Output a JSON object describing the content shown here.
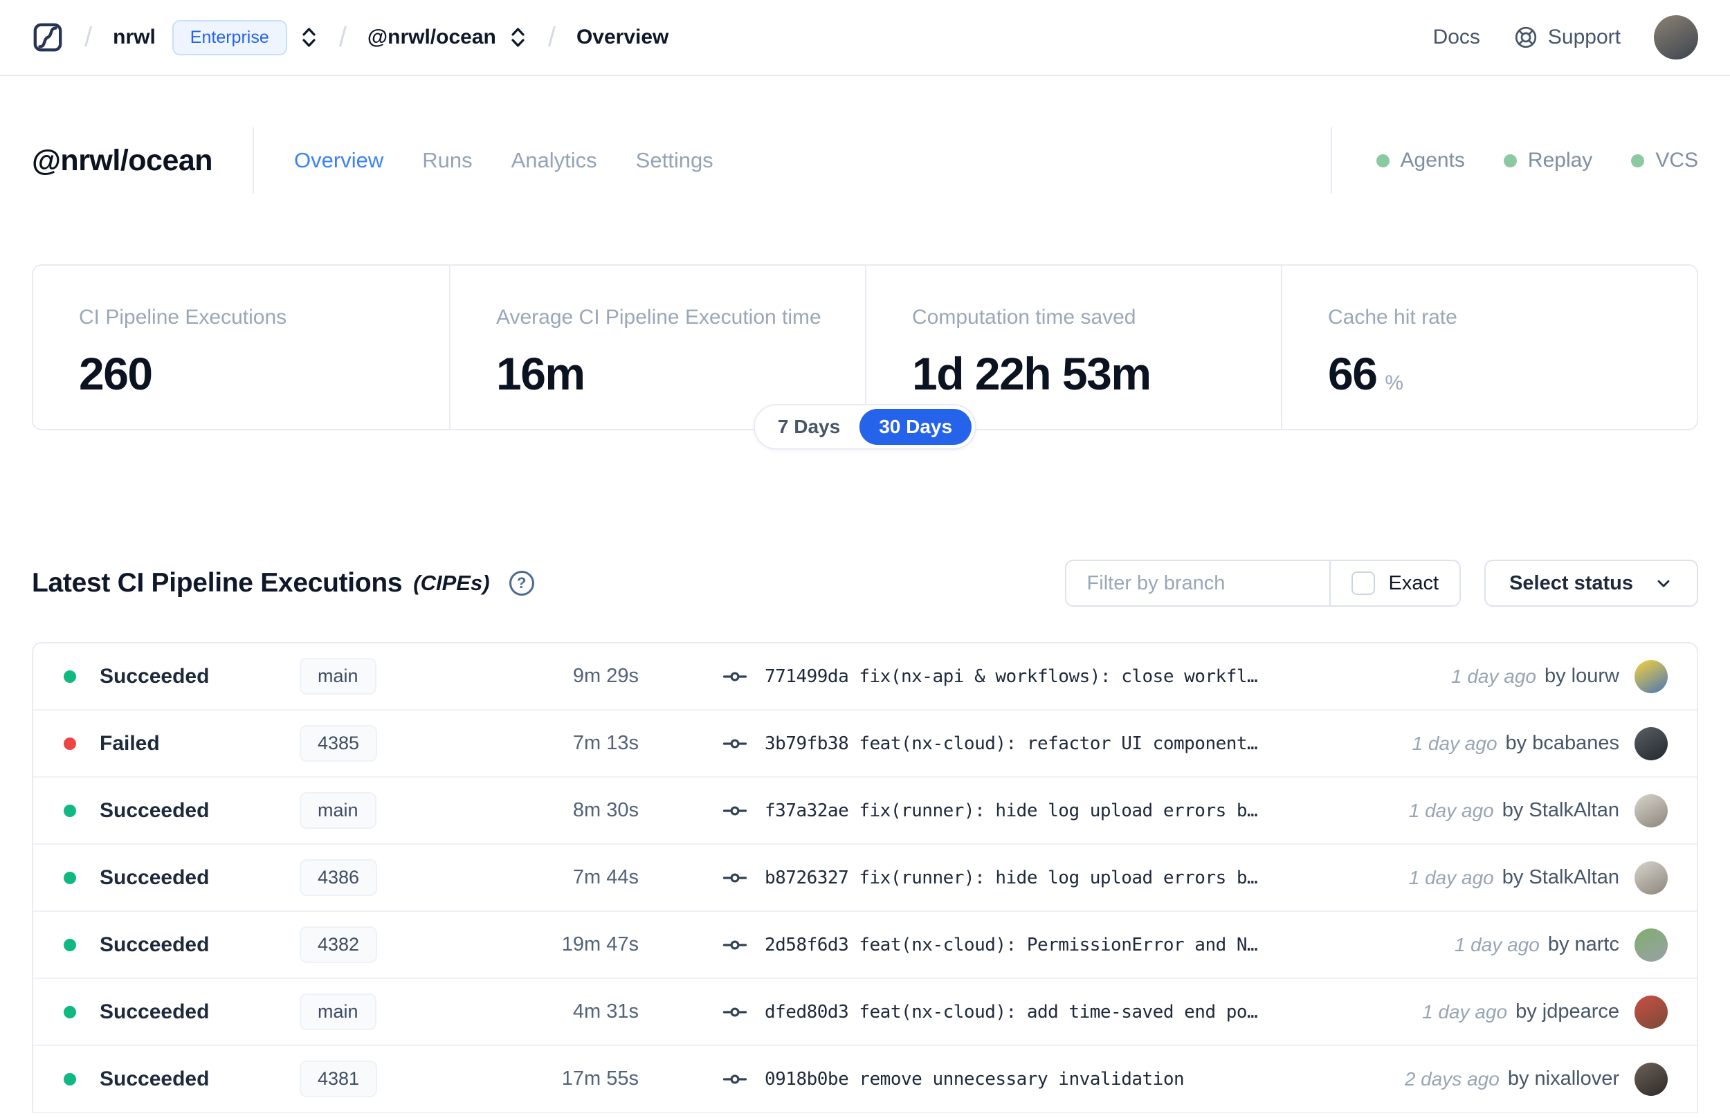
{
  "topbar": {
    "breadcrumb": {
      "separator": "/",
      "org": "nrwl",
      "org_badge": "Enterprise",
      "workspace": "@nrwl/ocean",
      "page": "Overview"
    },
    "docs_label": "Docs",
    "support_label": "Support",
    "user_avatar_colors": [
      "#8c8272",
      "#3c4450"
    ]
  },
  "header": {
    "title": "@nrwl/ocean",
    "tabs": [
      {
        "label": "Overview",
        "active": true
      },
      {
        "label": "Runs",
        "active": false
      },
      {
        "label": "Analytics",
        "active": false
      },
      {
        "label": "Settings",
        "active": false
      }
    ],
    "statuses": [
      {
        "label": "Agents",
        "dot_color": "#8bcaa1"
      },
      {
        "label": "Replay",
        "dot_color": "#8bcaa1"
      },
      {
        "label": "VCS",
        "dot_color": "#8bcaa1"
      }
    ]
  },
  "stats": {
    "cards": [
      {
        "label": "CI Pipeline Executions",
        "value": "260",
        "suffix": ""
      },
      {
        "label": "Average CI Pipeline Execution time",
        "value": "16m",
        "suffix": ""
      },
      {
        "label": "Computation time saved",
        "value": "1d 22h 53m",
        "suffix": ""
      },
      {
        "label": "Cache hit rate",
        "value": "66",
        "suffix": "%"
      }
    ],
    "range_toggle": {
      "options": [
        "7 Days",
        "30 Days"
      ],
      "selected": "30 Days",
      "selected_color": "#2563eb"
    }
  },
  "executions": {
    "title": "Latest CI Pipeline Executions",
    "title_suffix": "(CIPEs)",
    "help_glyph": "?",
    "filter_placeholder": "Filter by branch",
    "exact_label": "Exact",
    "status_select_label": "Select status",
    "status_colors": {
      "succeeded": "#10b981",
      "failed": "#ef4444"
    },
    "rows": [
      {
        "status": "Succeeded",
        "dot_color": "#10b981",
        "branch": "main",
        "duration": "9m 29s",
        "commit": "771499da fix(nx-api & workflows): close workfl…",
        "time": "1 day ago",
        "author": "by lourw",
        "avatar": [
          "#f6d33c",
          "#4a76b8"
        ]
      },
      {
        "status": "Failed",
        "dot_color": "#ef4444",
        "branch": "4385",
        "duration": "7m 13s",
        "commit": "3b79fb38 feat(nx-cloud): refactor UI component…",
        "time": "1 day ago",
        "author": "by bcabanes",
        "avatar": [
          "#5a5f66",
          "#23272e"
        ]
      },
      {
        "status": "Succeeded",
        "dot_color": "#10b981",
        "branch": "main",
        "duration": "8m 30s",
        "commit": "f37a32ae fix(runner): hide log upload errors b…",
        "time": "1 day ago",
        "author": "by StalkAltan",
        "avatar": [
          "#d8d4cd",
          "#8c857b"
        ]
      },
      {
        "status": "Succeeded",
        "dot_color": "#10b981",
        "branch": "4386",
        "duration": "7m 44s",
        "commit": "b8726327 fix(runner): hide log upload errors b…",
        "time": "1 day ago",
        "author": "by StalkAltan",
        "avatar": [
          "#d8d4cd",
          "#8c857b"
        ]
      },
      {
        "status": "Succeeded",
        "dot_color": "#10b981",
        "branch": "4382",
        "duration": "19m 47s",
        "commit": "2d58f6d3 feat(nx-cloud): PermissionError and N…",
        "time": "1 day ago",
        "author": "by nartc",
        "avatar": [
          "#7fae6e",
          "#9aa0a6"
        ]
      },
      {
        "status": "Succeeded",
        "dot_color": "#10b981",
        "branch": "main",
        "duration": "4m 31s",
        "commit": "dfed80d3 feat(nx-cloud): add time-saved end po…",
        "time": "1 day ago",
        "author": "by jdpearce",
        "avatar": [
          "#c94f43",
          "#7a4a3a"
        ]
      },
      {
        "status": "Succeeded",
        "dot_color": "#10b981",
        "branch": "4381",
        "duration": "17m 55s",
        "commit": "0918b0be remove unnecessary invalidation",
        "time": "2 days ago",
        "author": "by nixallover",
        "avatar": [
          "#6b6158",
          "#2e2a28"
        ]
      }
    ]
  }
}
